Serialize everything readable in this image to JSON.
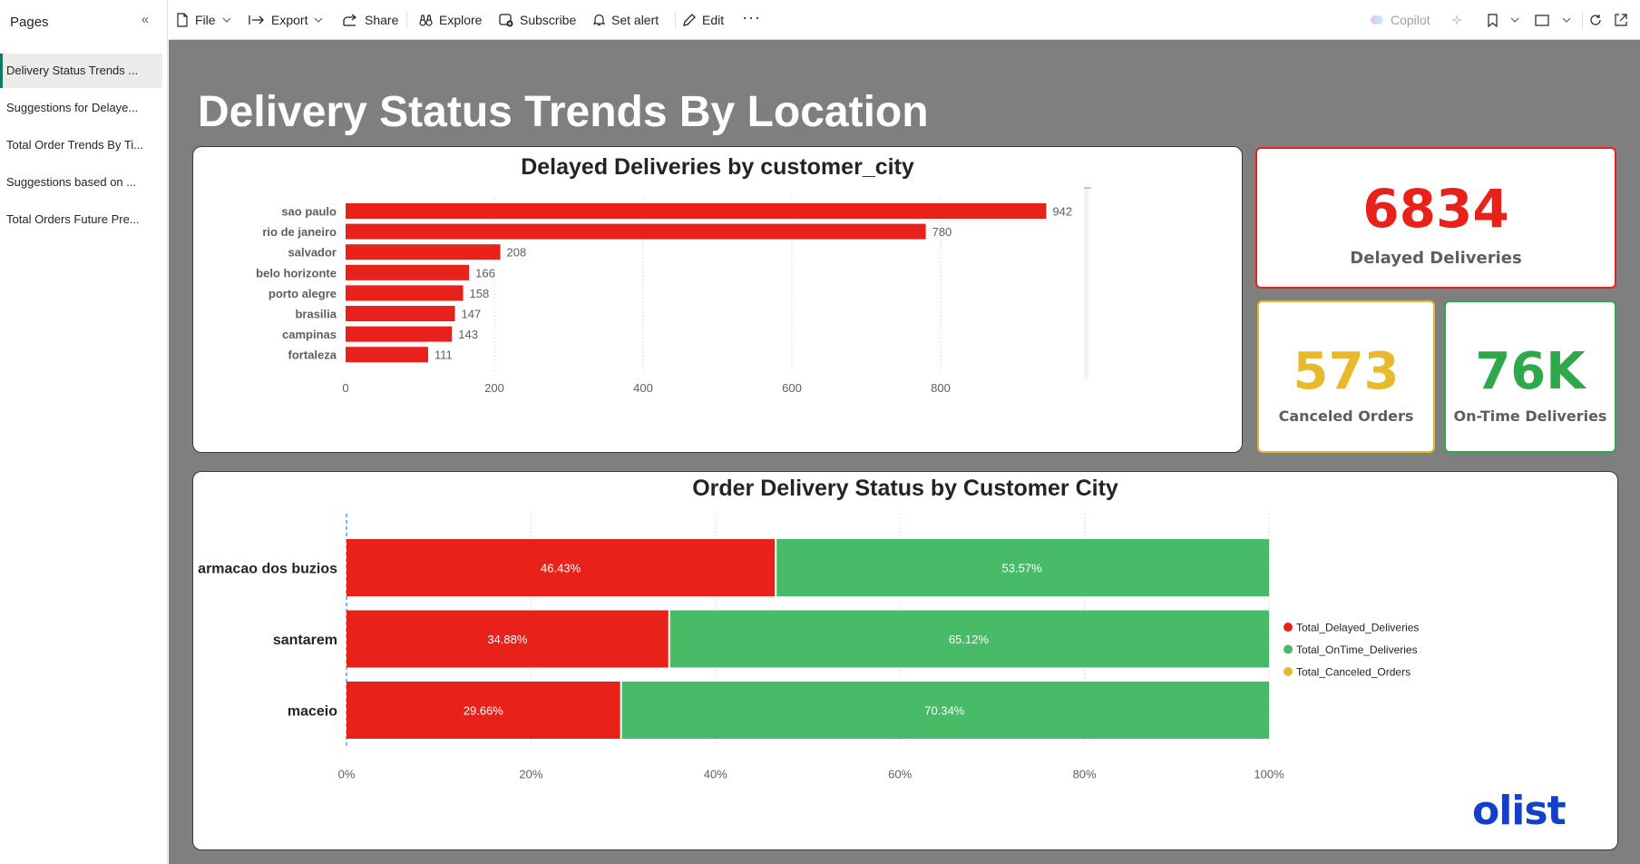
{
  "sidebar": {
    "title": "Pages",
    "pages": [
      {
        "label": "Delivery Status Trends ...",
        "active": true
      },
      {
        "label": "Suggestions for Delaye...",
        "active": false
      },
      {
        "label": "Total Order Trends By Ti...",
        "active": false
      },
      {
        "label": "Suggestions based on ...",
        "active": false
      },
      {
        "label": "Total Orders Future Pre...",
        "active": false
      }
    ]
  },
  "toolbar": {
    "file": "File",
    "export": "Export",
    "share": "Share",
    "explore": "Explore",
    "subscribe": "Subscribe",
    "set_alert": "Set alert",
    "edit": "Edit",
    "copilot": "Copilot"
  },
  "report": {
    "title": "Delivery Status Trends By Location"
  },
  "kpis": {
    "delayed": {
      "value": "6834",
      "label": "Delayed Deliveries",
      "color": "#e8211a"
    },
    "canceled": {
      "value": "573",
      "label": "Canceled Orders",
      "color": "#e9b92d"
    },
    "ontime": {
      "value": "76K",
      "label": "On-Time Deliveries",
      "color": "#2ea84a"
    }
  },
  "logo": {
    "text": "olist"
  },
  "colors": {
    "delayed": "#e8211a",
    "ontime": "#47bb68",
    "canceled": "#e9b92d",
    "canvas": "#7f7f7f"
  },
  "chart_data": [
    {
      "type": "bar",
      "orientation": "horizontal",
      "title": "Delayed Deliveries by customer_city",
      "categories": [
        "sao paulo",
        "rio de janeiro",
        "salvador",
        "belo horizonte",
        "porto alegre",
        "brasilia",
        "campinas",
        "fortaleza"
      ],
      "values": [
        942,
        780,
        208,
        166,
        158,
        147,
        143,
        111
      ],
      "xlim": [
        0,
        1000
      ],
      "xticks": [
        0,
        200,
        400,
        600,
        800
      ],
      "grid": true,
      "data_labels": true
    },
    {
      "type": "bar",
      "orientation": "horizontal",
      "stacked": "100%",
      "title": "Order Delivery Status by Customer City",
      "categories": [
        "armacao dos buzios",
        "santarem",
        "maceio"
      ],
      "series": [
        {
          "name": "Total_Delayed_Deliveries",
          "values": [
            46.43,
            34.88,
            29.66
          ]
        },
        {
          "name": "Total_OnTime_Deliveries",
          "values": [
            53.57,
            65.12,
            70.34
          ]
        },
        {
          "name": "Total_Canceled_Orders",
          "values": [
            0,
            0,
            0
          ]
        }
      ],
      "xticks": [
        "0%",
        "20%",
        "40%",
        "60%",
        "80%",
        "100%"
      ],
      "legend": "right",
      "grid": true
    }
  ]
}
